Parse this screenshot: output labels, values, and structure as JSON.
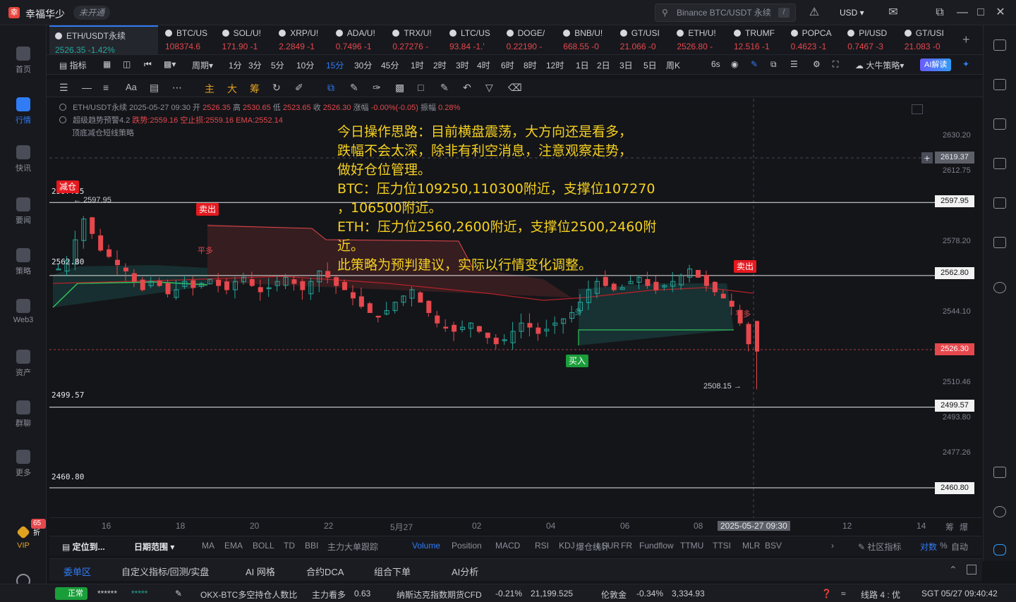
{
  "titlebar": {
    "app_name": "幸福华少",
    "status_pill": "未开通",
    "search_placeholder": "Binance BTC/USDT 永续",
    "search_shortcut": "/",
    "currency": "USD"
  },
  "sidebar": {
    "items": [
      {
        "label": "首页"
      },
      {
        "label": "行情"
      },
      {
        "label": "快讯"
      },
      {
        "label": "要闻"
      },
      {
        "label": "策略"
      },
      {
        "label": "Web3"
      },
      {
        "label": "资产"
      },
      {
        "label": "群聊"
      },
      {
        "label": "更多"
      },
      {
        "label": "VIP"
      }
    ],
    "vip_badge": "65折"
  },
  "symbol_tabs": [
    {
      "name": "ETH/USDT永续",
      "price": "2526.35",
      "change": "-1.42%"
    },
    {
      "name": "BTC/US",
      "price": "108374.6",
      "change": ""
    },
    {
      "name": "SOL/U!",
      "price": "171.90",
      "change": "-1"
    },
    {
      "name": "XRP/U!",
      "price": "2.2849",
      "change": "-1"
    },
    {
      "name": "ADA/U!",
      "price": "0.7496",
      "change": "-1"
    },
    {
      "name": "TRX/U!",
      "price": "0.27276",
      "change": "-"
    },
    {
      "name": "LTC/US",
      "price": "93.84",
      "change": "-1.'"
    },
    {
      "name": "DOGE/",
      "price": "0.22190",
      "change": "-"
    },
    {
      "name": "BNB/U!",
      "price": "668.55",
      "change": "-0"
    },
    {
      "name": "GT/USI",
      "price": "21.066",
      "change": "-0"
    },
    {
      "name": "ETH/U!",
      "price": "2526.80",
      "change": "-"
    },
    {
      "name": "TRUMF",
      "price": "12.516",
      "change": "-1"
    },
    {
      "name": "POPCA",
      "price": "0.4623",
      "change": "-1"
    },
    {
      "name": "PI/USD",
      "price": "0.7467",
      "change": "-3"
    },
    {
      "name": "GT/USI",
      "price": "21.083",
      "change": "-0"
    }
  ],
  "intervals": {
    "indicator_label": "指标",
    "period_label": "周期",
    "list": [
      "1分",
      "3分",
      "5分",
      "10分",
      "15分",
      "30分",
      "45分",
      "1时",
      "2时",
      "3时",
      "4时",
      "6时",
      "8时",
      "12时",
      "1日",
      "2日",
      "3日",
      "5日",
      "周K"
    ],
    "selected": "15分",
    "countdown": "6s",
    "strategy_label": "大牛策略",
    "ai_button": "AI解读"
  },
  "drawbar": {
    "text_tool": "Aa",
    "chip_tools": [
      "主",
      "大",
      "筹"
    ]
  },
  "chart": {
    "header_line1": {
      "symbol": "ETH/USDT永续 2025-05-27 09:30",
      "open_label": "开",
      "open": "2526.35",
      "high_label": "高",
      "high": "2530.65",
      "low_label": "低",
      "low": "2523.65",
      "close_label": "收",
      "close": "2526.30",
      "chg_label": "涨幅",
      "chg": "-0.00%(-0.05)",
      "amp_label": "振幅",
      "amp": "0.28%"
    },
    "header_line2": {
      "indicator": "超级趋势预警4.2",
      "stop_long": "跌势:2559.16",
      "stop_short": "空止损:2559.16",
      "ema": "EMA:2552.14"
    },
    "header_line3": "顶底减仓短线策略",
    "strategy_text": [
      "今日操作思路：目前横盘震荡，大方向还是看多，",
      "跌幅不会太深，除非有利空消息，注意观察走势，",
      "做好仓位管理。",
      "BTC：压力位109250,110300附近，支撑位107270",
      "，106500附近。",
      "ETH：压力位2560,2600附近，支撑位2500,2460附",
      "近。",
      "此策略为预判建议，实际以行情变化调整。"
    ],
    "horizontal_lines": [
      "2597.95",
      "2562.80",
      "2499.57",
      "2460.80"
    ],
    "y_ticks": [
      "2630.20",
      "2612.75",
      "2595.42",
      "2578.20",
      "2544.10",
      "2510.46",
      "2493.80",
      "2477.26"
    ],
    "y_boxes": {
      "crosshair": "2619.37",
      "line1": "2597.95",
      "line2": "2562.80",
      "current": "2526.30",
      "line3": "2499.57",
      "line4": "2460.80"
    },
    "signals": {
      "reduce": "减仓",
      "sell1": "卖出",
      "sell2": "卖出",
      "buy": "买入",
      "flat_long1": "平多",
      "flat_long2": "平多",
      "short_mark": "多"
    },
    "high_marker": "2597.95",
    "low_marker": "2508.15",
    "colors": {
      "up": "#26a69a",
      "down": "#e5484d",
      "strategy_text": "#f5d020",
      "accent": "#2f7cf6"
    }
  },
  "xaxis": {
    "ticks": [
      "16",
      "18",
      "20",
      "22",
      "5月27",
      "02",
      "04",
      "06",
      "08",
      "12",
      "14"
    ],
    "crosshair_time": "2025-05-27 09:30",
    "right_labels": [
      "筹",
      "爆"
    ]
  },
  "indicator_bar": {
    "locate": "定位到...",
    "date_range": "日期范围",
    "items": [
      "MA",
      "EMA",
      "BOLL",
      "TD",
      "BBI",
      "主力大单跟踪",
      "Volume",
      "Position",
      "MACD",
      "RSI",
      "KDJ",
      "爆仓统计",
      "LSUR",
      "FR",
      "Fundflow",
      "TTMU",
      "TTSI",
      "MLR",
      "BSV"
    ],
    "selected": "Volume",
    "community": "社区指标",
    "compare": "对数",
    "percent": "%",
    "auto": "自动"
  },
  "panel_tabs": [
    "委单区",
    "自定义指标/回测/实盘",
    "AI 网格",
    "合约DCA",
    "组合下单",
    "AI分析"
  ],
  "statusbar": {
    "status": "正常",
    "masked_account": "******",
    "masked_balance": "*****",
    "ticker1_name": "OKX-BTC多空持仓人数比",
    "ticker1_tag": "主力看多",
    "ticker1_value": "0.63",
    "ticker2_name": "纳斯达克指数期货CFD",
    "ticker2_change": "-0.21%",
    "ticker2_value": "21,199.525",
    "ticker3_name": "伦敦金",
    "ticker3_change": "-0.34%",
    "ticker3_value": "3,334.93",
    "line": "线路 4 : 优",
    "clock": "SGT 05/27 09:40:42"
  }
}
